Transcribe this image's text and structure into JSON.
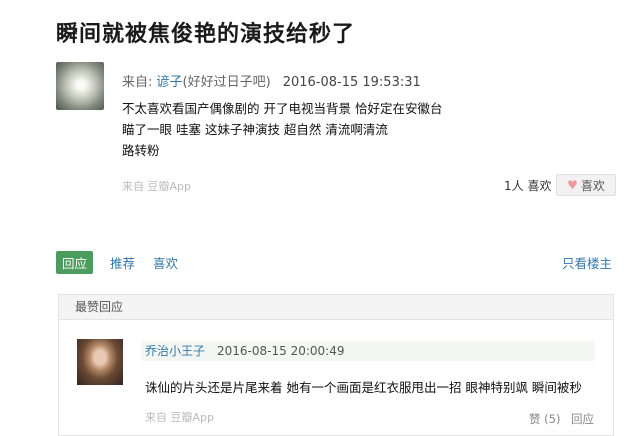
{
  "title": "瞬间就被焦俊艳的演技给秒了",
  "post": {
    "from_prefix": "来自: ",
    "author": "谚子",
    "group": "(好好过日子吧)",
    "time": "2016-08-15 19:53:31",
    "lines": [
      "不太喜欢看国产偶像剧的 开了电视当背景 恰好定在安徽台",
      "瞄了一眼 哇塞 这妹子神演技 超自然 清流啊清流",
      "路转粉"
    ],
    "source": "来自 豆瓣App",
    "like_count": "1人 喜欢",
    "like_button": "喜欢"
  },
  "actions": {
    "reply": "回应",
    "recommend": "推荐",
    "like": "喜欢",
    "owner_only": "只看楼主"
  },
  "hot_replies": {
    "header": "最赞回应",
    "comment": {
      "author": "乔治小王子",
      "time": "2016-08-15 20:00:49",
      "body": "诛仙的片头还是片尾来着 她有一个画面是红衣服甩出一招 眼神特别飒 瞬间被秒",
      "source": "来自 豆瓣App",
      "like": "赞 (5)",
      "reply": "回应"
    }
  },
  "colors": {
    "link": "#3377aa",
    "reply_button": "#4c9c5d"
  }
}
